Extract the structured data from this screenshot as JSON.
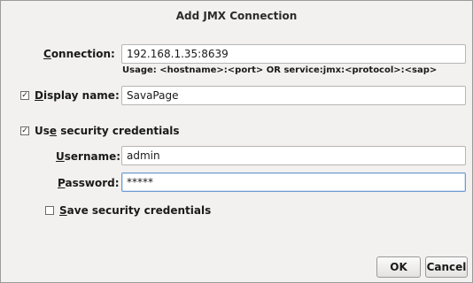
{
  "dialog": {
    "title": "Add JMX Connection"
  },
  "connection": {
    "label_accel": "C",
    "label_rest": "onnection:",
    "value": "192.168.1.35:8639",
    "usage": "Usage: <hostname>:<port> OR service:jmx:<protocol>:<sap>"
  },
  "display_name": {
    "checked": true,
    "label_accel": "D",
    "label_rest": "isplay name:",
    "value": "SavaPage"
  },
  "security": {
    "checked": true,
    "label_pre": "Us",
    "label_accel": "e",
    "label_post": " security credentials"
  },
  "username": {
    "label_accel": "U",
    "label_rest": "sername:",
    "value": "admin"
  },
  "password": {
    "label_accel": "P",
    "label_rest": "assword:",
    "value": "*****"
  },
  "save_credentials": {
    "checked": false,
    "label_accel": "S",
    "label_rest": "ave security credentials"
  },
  "buttons": {
    "ok": "OK",
    "cancel": "Cancel"
  }
}
